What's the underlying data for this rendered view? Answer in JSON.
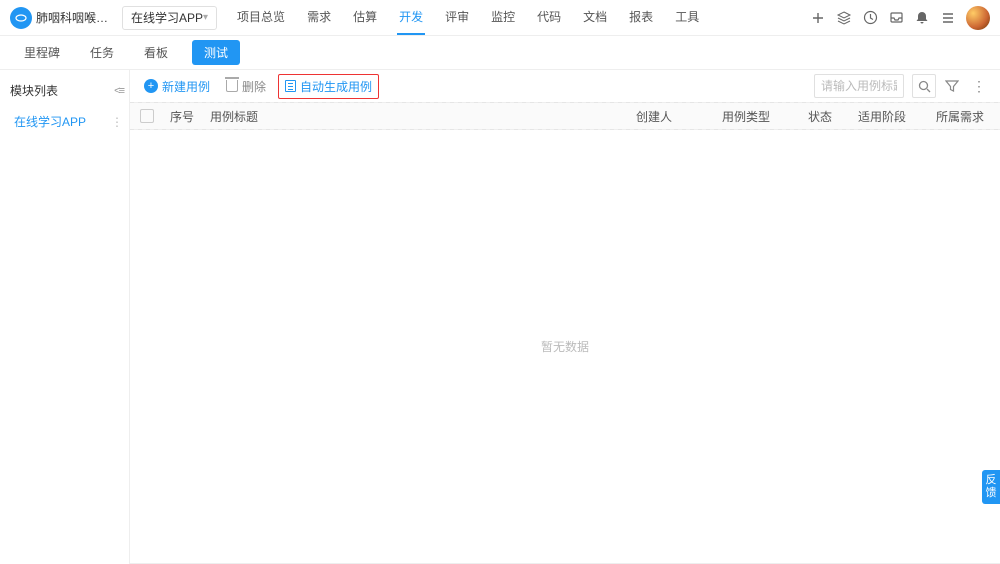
{
  "top": {
    "team": "肺咽科咽喉的团队…",
    "project": "在线学习APP",
    "nav": [
      "项目总览",
      "需求",
      "估算",
      "开发",
      "评审",
      "监控",
      "代码",
      "文档",
      "报表",
      "工具"
    ],
    "nav_active_index": 3
  },
  "subnav": {
    "items": [
      "里程碑",
      "任务",
      "看板",
      "测试"
    ],
    "active_index": 3
  },
  "sidebar": {
    "title": "模块列表",
    "item1_label": "在线学习APP"
  },
  "toolbar": {
    "new_case": "新建用例",
    "delete": "删除",
    "auto_gen": "自动生成用例",
    "search_placeholder": "请输入用例标题"
  },
  "table": {
    "headers": {
      "seq": "序号",
      "title": "用例标题",
      "creator": "创建人",
      "type": "用例类型",
      "status": "状态",
      "stage": "适用阶段",
      "req": "所属需求"
    },
    "empty": "暂无数据"
  },
  "feedback_label": "反馈"
}
